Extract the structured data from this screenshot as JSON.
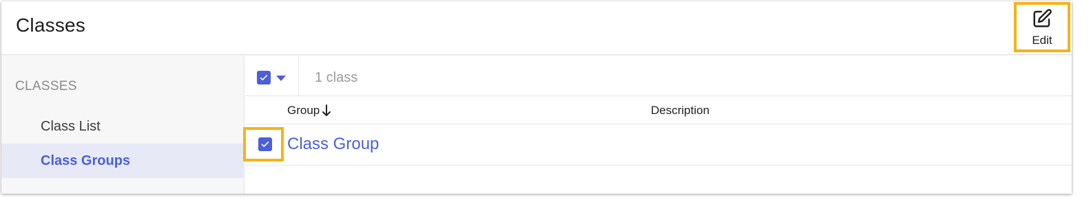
{
  "header": {
    "title": "Classes",
    "edit_label": "Edit"
  },
  "sidebar": {
    "section": "CLASSES",
    "items": [
      {
        "label": "Class List",
        "active": false
      },
      {
        "label": "Class Groups",
        "active": true
      }
    ]
  },
  "toolbar": {
    "count": "1 class"
  },
  "table": {
    "columns": [
      "Group",
      "Description"
    ],
    "sort_icon": "arrow-down-icon",
    "rows": [
      {
        "group": "Class Group",
        "description": "",
        "checked": true
      }
    ]
  },
  "colors": {
    "accent": "#4b5fd8",
    "highlight": "#f5b316",
    "active_bg": "#e7e9f7"
  }
}
